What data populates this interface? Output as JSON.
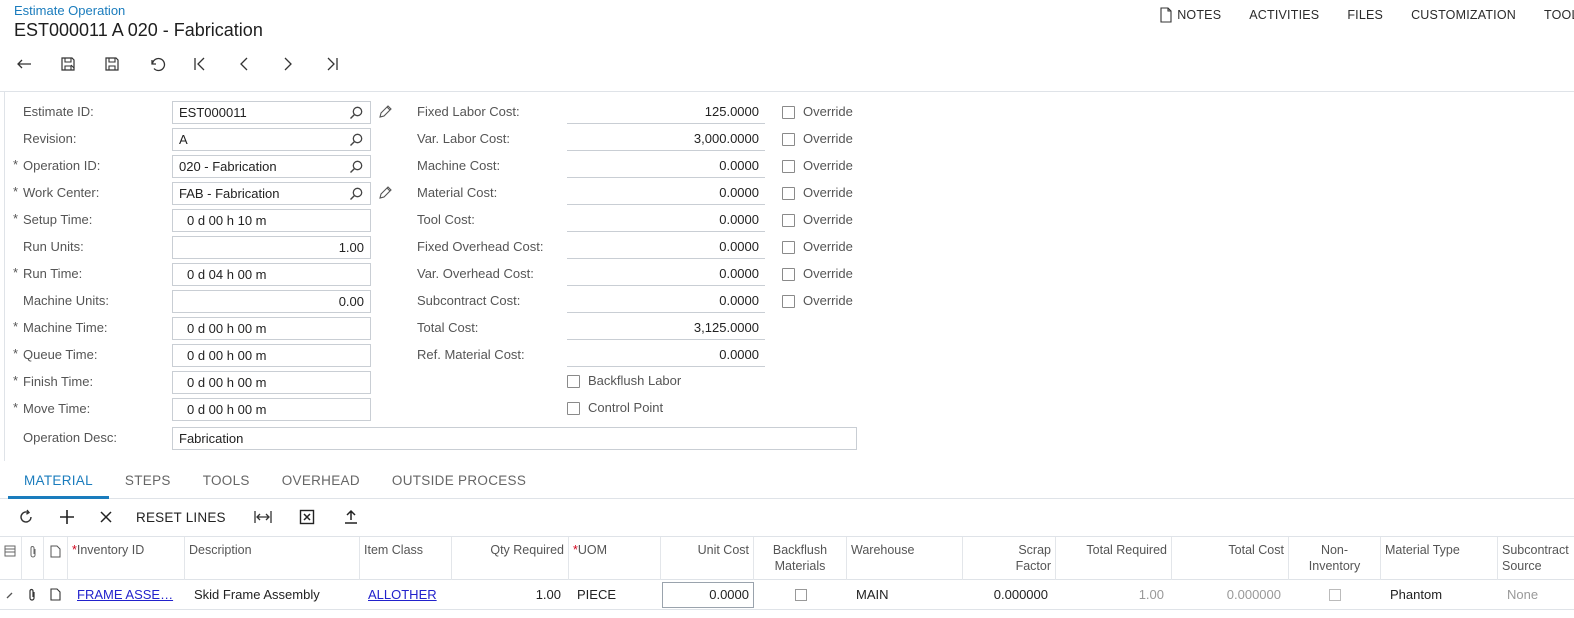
{
  "header": {
    "breadcrumb": "Estimate Operation",
    "title": "EST000011 A 020 - Fabrication",
    "links": {
      "notes": "NOTES",
      "activities": "ACTIVITIES",
      "files": "FILES",
      "customization": "CUSTOMIZATION",
      "tools": "TOOLS"
    }
  },
  "toolbar": {
    "icons": [
      "back-icon",
      "save-and-close-icon",
      "save-icon",
      "undo-icon",
      "first-record-icon",
      "previous-record-icon",
      "next-record-icon",
      "last-record-icon"
    ]
  },
  "form": {
    "estimate_id": {
      "label": "Estimate ID:",
      "value": "EST000011"
    },
    "revision": {
      "label": "Revision:",
      "value": "A"
    },
    "operation_id": {
      "label": "Operation ID:",
      "value": "020 - Fabrication"
    },
    "work_center": {
      "label": "Work Center:",
      "value": "FAB - Fabrication"
    },
    "setup_time": {
      "label": "Setup Time:",
      "value": "0 d 00 h 10 m"
    },
    "run_units": {
      "label": "Run Units:",
      "value": "1.00"
    },
    "run_time": {
      "label": "Run Time:",
      "value": "0 d 04 h 00 m"
    },
    "machine_units": {
      "label": "Machine Units:",
      "value": "0.00"
    },
    "machine_time": {
      "label": "Machine Time:",
      "value": "0 d 00 h 00 m"
    },
    "queue_time": {
      "label": "Queue Time:",
      "value": "0 d 00 h 00 m"
    },
    "finish_time": {
      "label": "Finish Time:",
      "value": "0 d 00 h 00 m"
    },
    "move_time": {
      "label": "Move Time:",
      "value": "0 d 00 h 00 m"
    },
    "operation_desc": {
      "label": "Operation Desc:",
      "value": "Fabrication"
    },
    "required_marker": "*"
  },
  "costs": {
    "override_label": "Override",
    "fixed_labor": {
      "label": "Fixed Labor Cost:",
      "value": "125.0000"
    },
    "var_labor": {
      "label": "Var. Labor Cost:",
      "value": "3,000.0000"
    },
    "machine": {
      "label": "Machine Cost:",
      "value": "0.0000"
    },
    "material": {
      "label": "Material Cost:",
      "value": "0.0000"
    },
    "tool": {
      "label": "Tool Cost:",
      "value": "0.0000"
    },
    "fixed_overhead": {
      "label": "Fixed Overhead Cost:",
      "value": "0.0000"
    },
    "var_overhead": {
      "label": "Var. Overhead Cost:",
      "value": "0.0000"
    },
    "subcontract": {
      "label": "Subcontract Cost:",
      "value": "0.0000"
    },
    "total": {
      "label": "Total Cost:",
      "value": "3,125.0000"
    },
    "ref_material": {
      "label": "Ref. Material Cost:",
      "value": "0.0000"
    },
    "backflush_labor": "Backflush Labor",
    "control_point": "Control Point"
  },
  "tabs": [
    "MATERIAL",
    "STEPS",
    "TOOLS",
    "OVERHEAD",
    "OUTSIDE PROCESS"
  ],
  "grid_toolbar": {
    "reset_lines": "RESET LINES"
  },
  "grid": {
    "headers": {
      "inventory_id": "Inventory ID",
      "description": "Description",
      "item_class": "Item Class",
      "qty_required": "Qty Required",
      "uom": "UOM",
      "unit_cost": "Unit Cost",
      "backflush_1": "Backflush",
      "backflush_2": "Materials",
      "warehouse": "Warehouse",
      "scrap_1": "Scrap",
      "scrap_2": "Factor",
      "total_required": "Total Required",
      "total_cost": "Total Cost",
      "non_inv_1": "Non-",
      "non_inv_2": "Inventory",
      "material_type": "Material Type",
      "subcontract_1": "Subcontract",
      "subcontract_2": "Source"
    },
    "row": {
      "inventory_id": "FRAME ASSE…",
      "description": "Skid Frame Assembly",
      "item_class": "ALLOTHER",
      "qty_required": "1.00",
      "uom": "PIECE",
      "unit_cost": "0.0000",
      "warehouse": "MAIN",
      "scrap_factor": "0.000000",
      "total_required": "1.00",
      "total_cost": "0.000000",
      "material_type": "Phantom",
      "subcontract_source": "None"
    }
  }
}
